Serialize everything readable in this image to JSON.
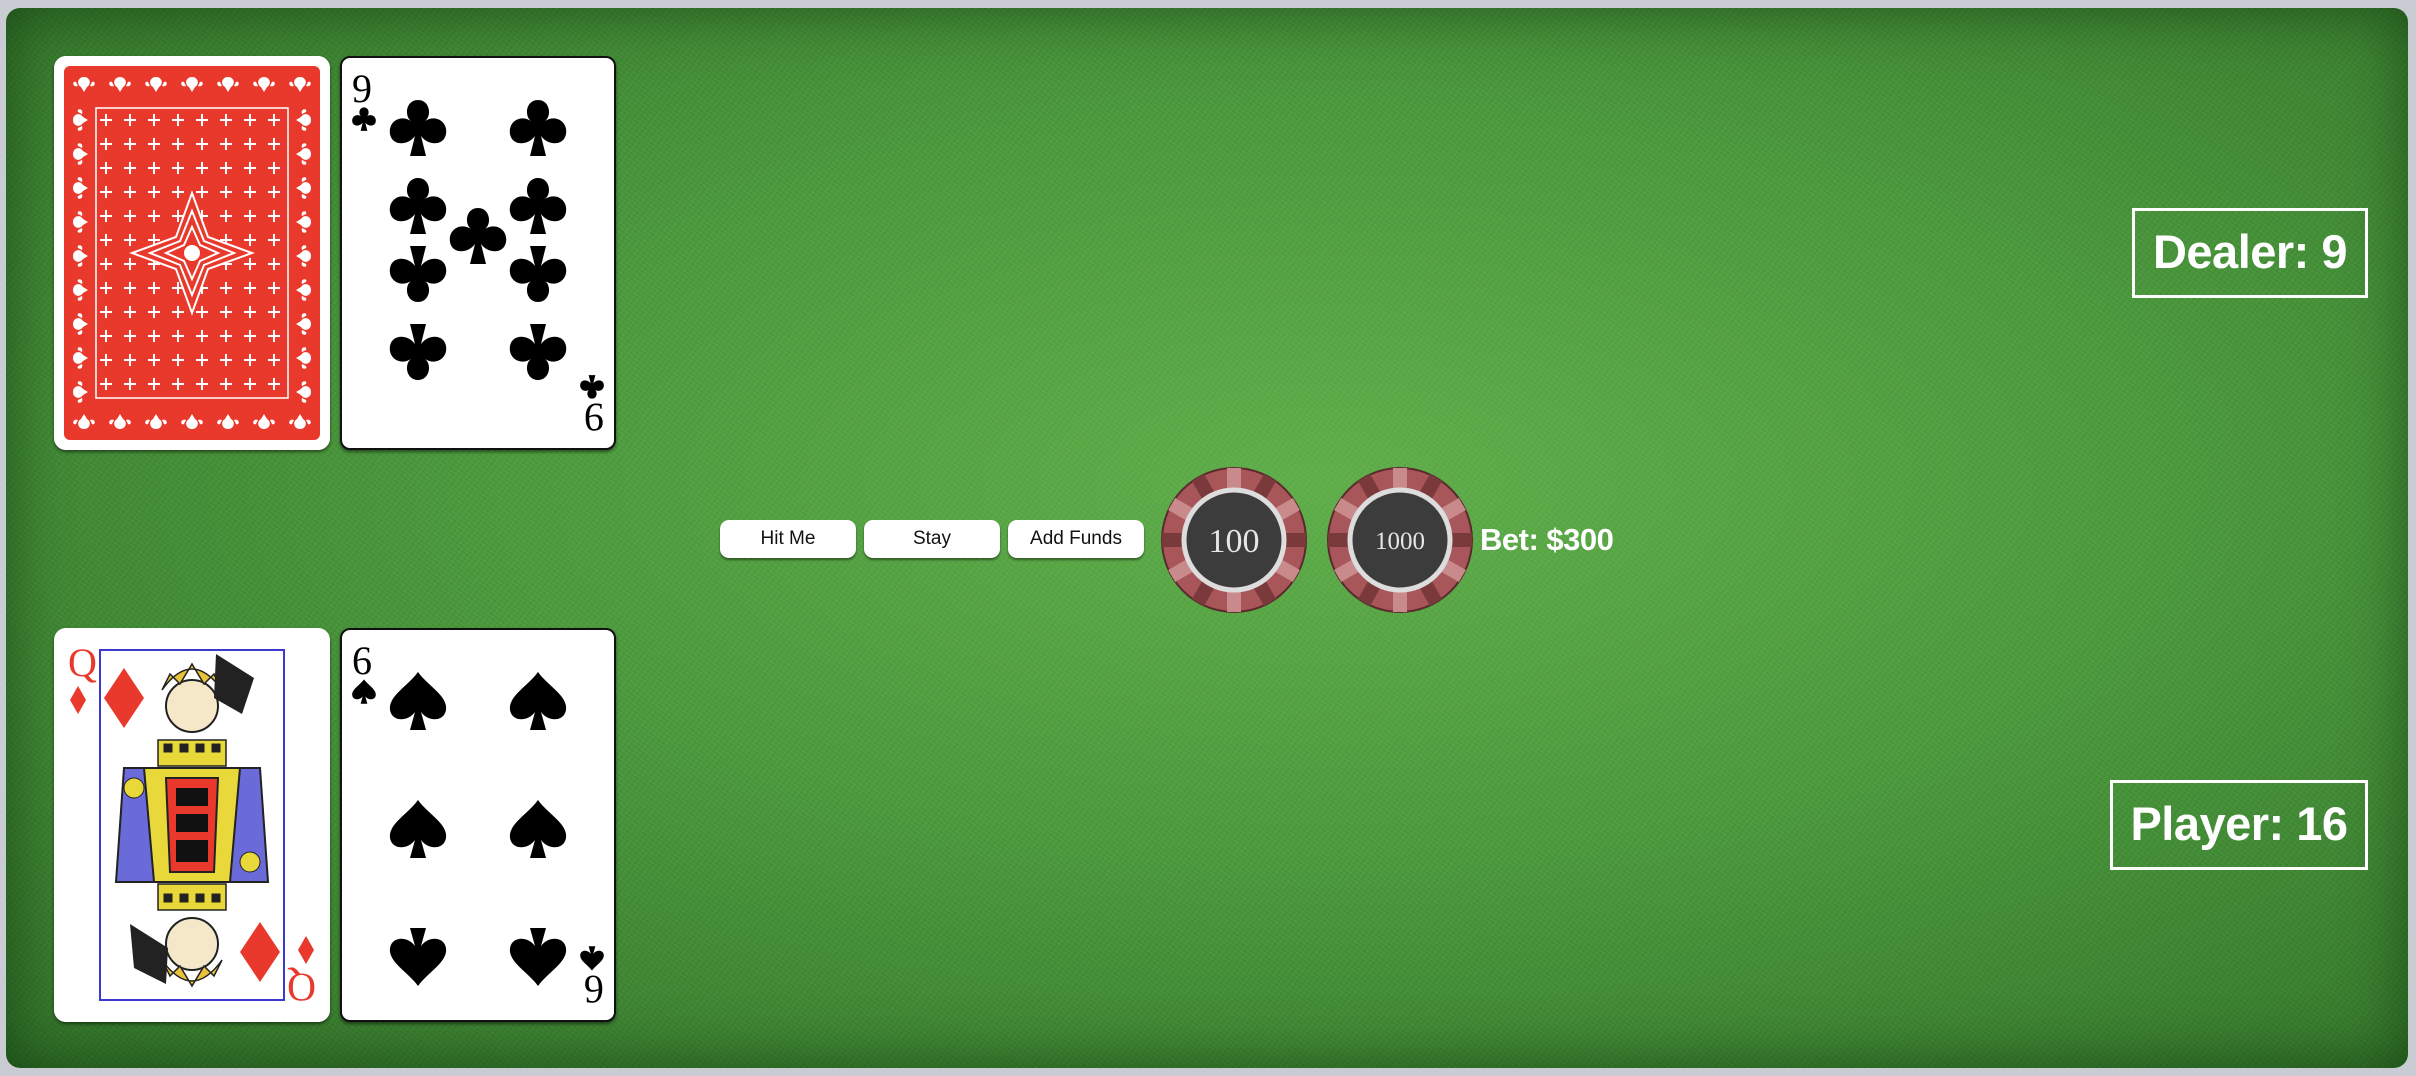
{
  "dealer": {
    "score_label": "Dealer: 9",
    "cards": [
      {
        "face": "down",
        "back_color": "#e8392c"
      },
      {
        "face": "up",
        "rank": "9",
        "suit": "clubs"
      }
    ]
  },
  "player": {
    "score_label": "Player: 16",
    "cards": [
      {
        "face": "up",
        "rank": "Q",
        "suit": "diamonds"
      },
      {
        "face": "up",
        "rank": "6",
        "suit": "spades"
      }
    ]
  },
  "controls": {
    "hit_label": "Hit Me",
    "stay_label": "Stay",
    "add_funds_label": "Add Funds"
  },
  "chips": [
    {
      "value": "100",
      "color": "#a8565a"
    },
    {
      "value": "1000",
      "color": "#a8565a"
    }
  ],
  "bet_label": "Bet: $300",
  "colors": {
    "felt": "#4a9a3c",
    "red_suit": "#e8392c",
    "black_suit": "#000000"
  }
}
